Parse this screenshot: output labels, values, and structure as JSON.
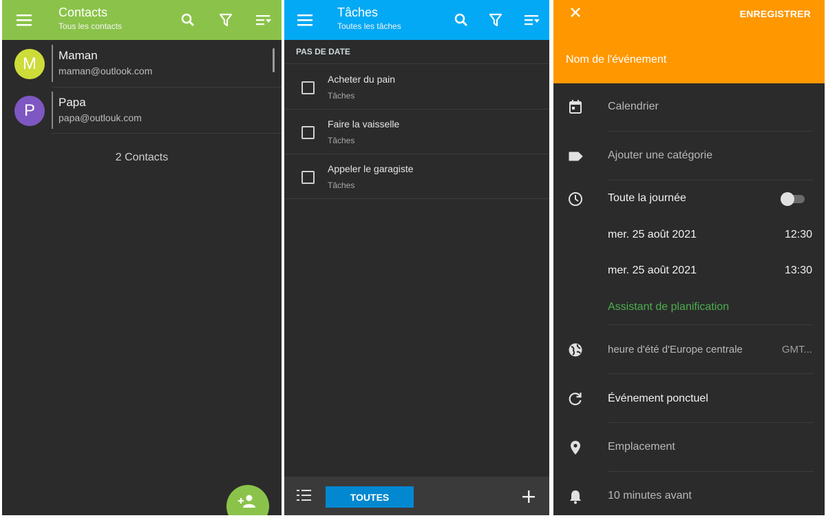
{
  "contacts": {
    "title": "Contacts",
    "subtitle": "Tous les contacts",
    "items": [
      {
        "initial": "M",
        "name": "Maman",
        "email": "maman@outlook.com",
        "avatar_color": "#cddc39"
      },
      {
        "initial": "P",
        "name": "Papa",
        "email": "papa@outlouk.com",
        "avatar_color": "#7e57c2"
      }
    ],
    "count_label": "2 Contacts",
    "accent_color": "#8bc34a",
    "icons": [
      "menu-icon",
      "search-icon",
      "filter-icon",
      "sort-icon",
      "add-person-icon"
    ]
  },
  "tasks": {
    "title": "Tâches",
    "subtitle": "Toutes les tâches",
    "section": "PAS DE DATE",
    "items": [
      {
        "title": "Acheter du pain",
        "list": "Tâches"
      },
      {
        "title": "Faire la vaisselle",
        "list": "Tâches"
      },
      {
        "title": "Appeler le garagiste",
        "list": "Tâches"
      }
    ],
    "bottom_tab": "TOUTES",
    "accent_color": "#03a9f4",
    "icons": [
      "menu-icon",
      "search-icon",
      "filter-icon",
      "sort-icon",
      "list-icon",
      "plus-icon"
    ]
  },
  "event": {
    "save_label": "ENREGISTRER",
    "name_placeholder": "Nom de l'événement",
    "calendar": "Calendrier",
    "category": "Ajouter une catégorie",
    "all_day_label": "Toute la journée",
    "all_day_enabled": false,
    "start_date": "mer. 25 août 2021",
    "start_time": "12:30",
    "end_date": "mer. 25 août 2021",
    "end_time": "13:30",
    "scheduling_assistant": "Assistant de planification",
    "timezone": "heure d'été d'Europe centrale",
    "timezone_offset": "GMT...",
    "recurrence": "Événement ponctuel",
    "location": "Emplacement",
    "reminder": "10 minutes avant",
    "accent_color": "#ff9800",
    "icons": [
      "close-icon",
      "calendar-icon",
      "tag-icon",
      "clock-icon",
      "globe-icon",
      "repeat-icon",
      "location-pin-icon",
      "bell-icon"
    ]
  }
}
